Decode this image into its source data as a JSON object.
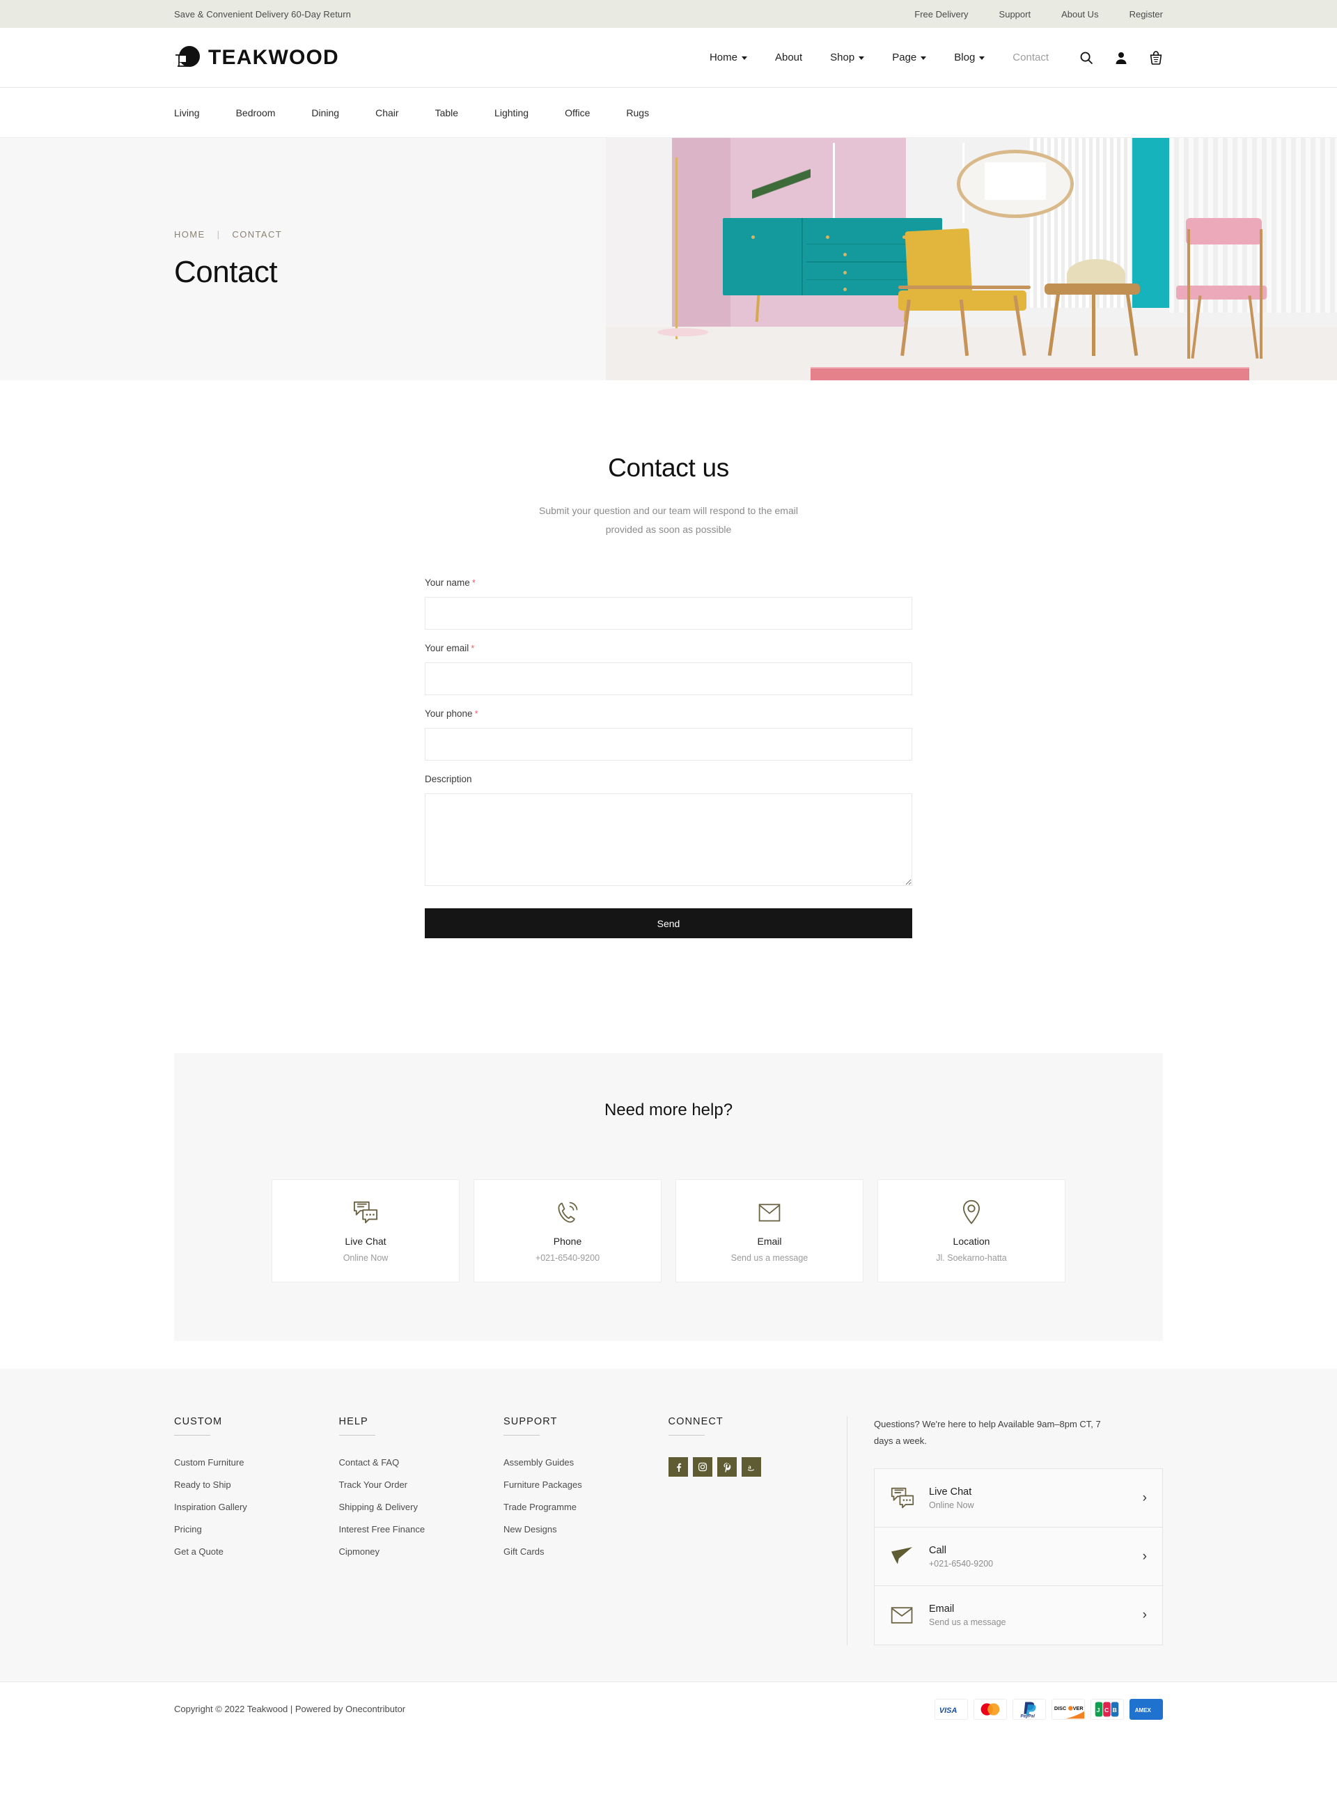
{
  "topbar": {
    "promo": "Save & Convenient Delivery 60-Day Return",
    "links": [
      {
        "label": "Free Delivery"
      },
      {
        "label": "Support"
      },
      {
        "label": "About Us"
      },
      {
        "label": "Register"
      }
    ]
  },
  "header": {
    "brand": "TEAKWOOD",
    "nav": [
      {
        "label": "Home",
        "caret": true,
        "active": false
      },
      {
        "label": "About",
        "caret": false,
        "active": false
      },
      {
        "label": "Shop",
        "caret": true,
        "active": false
      },
      {
        "label": "Page",
        "caret": true,
        "active": false
      },
      {
        "label": "Blog",
        "caret": true,
        "active": false
      },
      {
        "label": "Contact",
        "caret": false,
        "active": true
      }
    ],
    "icons": [
      "search-icon",
      "user-icon",
      "cart-icon"
    ]
  },
  "categories": [
    {
      "label": "Living"
    },
    {
      "label": "Bedroom"
    },
    {
      "label": "Dining"
    },
    {
      "label": "Chair"
    },
    {
      "label": "Table"
    },
    {
      "label": "Lighting"
    },
    {
      "label": "Office"
    },
    {
      "label": "Rugs"
    }
  ],
  "hero": {
    "breadcrumb_home": "HOME",
    "breadcrumb_sep": "|",
    "breadcrumb_current": "CONTACT",
    "title": "Contact"
  },
  "contact": {
    "heading": "Contact us",
    "subheading": "Submit your question and our team will respond to the email provided as soon as possible",
    "fields": [
      {
        "label": "Your name",
        "required": true,
        "value": "",
        "placeholder": ""
      },
      {
        "label": "Your email",
        "required": true,
        "value": "",
        "placeholder": ""
      },
      {
        "label": "Your phone",
        "required": true,
        "value": "",
        "placeholder": ""
      }
    ],
    "description_label": "Description",
    "description_value": "",
    "description_placeholder": "",
    "required_mark": "*",
    "send_label": "Send"
  },
  "help": {
    "heading": "Need more help?",
    "cards": [
      {
        "icon": "chat-bubbles-icon",
        "title": "Live Chat",
        "subtitle": "Online Now"
      },
      {
        "icon": "phone-call-icon",
        "title": "Phone",
        "subtitle": "+021-6540-9200"
      },
      {
        "icon": "envelope-icon",
        "title": "Email",
        "subtitle": "Send us a message"
      },
      {
        "icon": "map-pin-icon",
        "title": "Location",
        "subtitle": "Jl. Soekarno-hatta"
      }
    ]
  },
  "footer": {
    "columns": [
      {
        "title": "CUSTOM",
        "links": [
          {
            "label": "Custom Furniture"
          },
          {
            "label": "Ready to Ship"
          },
          {
            "label": "Inspiration Gallery"
          },
          {
            "label": "Pricing"
          },
          {
            "label": "Get a Quote"
          }
        ]
      },
      {
        "title": "HELP",
        "links": [
          {
            "label": "Contact & FAQ"
          },
          {
            "label": "Track Your Order"
          },
          {
            "label": "Shipping & Delivery"
          },
          {
            "label": "Interest Free Finance"
          },
          {
            "label": "Cipmoney"
          }
        ]
      },
      {
        "title": "SUPPORT",
        "links": [
          {
            "label": "Assembly Guides"
          },
          {
            "label": "Furniture Packages"
          },
          {
            "label": "Trade Programme"
          },
          {
            "label": "New Designs"
          },
          {
            "label": "Gift Cards"
          }
        ]
      }
    ],
    "connect": {
      "title": "CONNECT",
      "socials": [
        {
          "icon": "facebook-icon"
        },
        {
          "icon": "instagram-icon"
        },
        {
          "icon": "pinterest-icon"
        },
        {
          "icon": "amazon-icon"
        }
      ],
      "color": "#5f5c33"
    },
    "blurb": "Questions? We're here to help Available 9am–8pm CT, 7 days a week.",
    "rows": [
      {
        "icon": "chat-bubbles-icon",
        "title": "Live Chat",
        "subtitle": "Online Now",
        "chevron": "›"
      },
      {
        "icon": "paper-plane-icon",
        "title": "Call",
        "subtitle": "+021-6540-9200",
        "chevron": "›"
      },
      {
        "icon": "envelope-icon",
        "title": "Email",
        "subtitle": "Send us a message",
        "chevron": "›"
      }
    ]
  },
  "bottombar": {
    "copyright": "Copyright © 2022 Teakwood | Powered by Onecontributor",
    "payments": [
      {
        "name": "visa-logo",
        "label": "VISA"
      },
      {
        "name": "mastercard-logo",
        "label": "Mastercard"
      },
      {
        "name": "paypal-logo",
        "label": "PayPal"
      },
      {
        "name": "discover-logo",
        "label": "DISCOVER"
      },
      {
        "name": "jcb-logo",
        "label": "JCB"
      },
      {
        "name": "amex-logo",
        "label": "AMEX"
      }
    ]
  },
  "colors": {
    "topbar_bg": "#e9ebe2",
    "accent_olive": "#5f5c33",
    "crumb": "#8a8371",
    "required": "#e8616d",
    "button": "#151515"
  }
}
